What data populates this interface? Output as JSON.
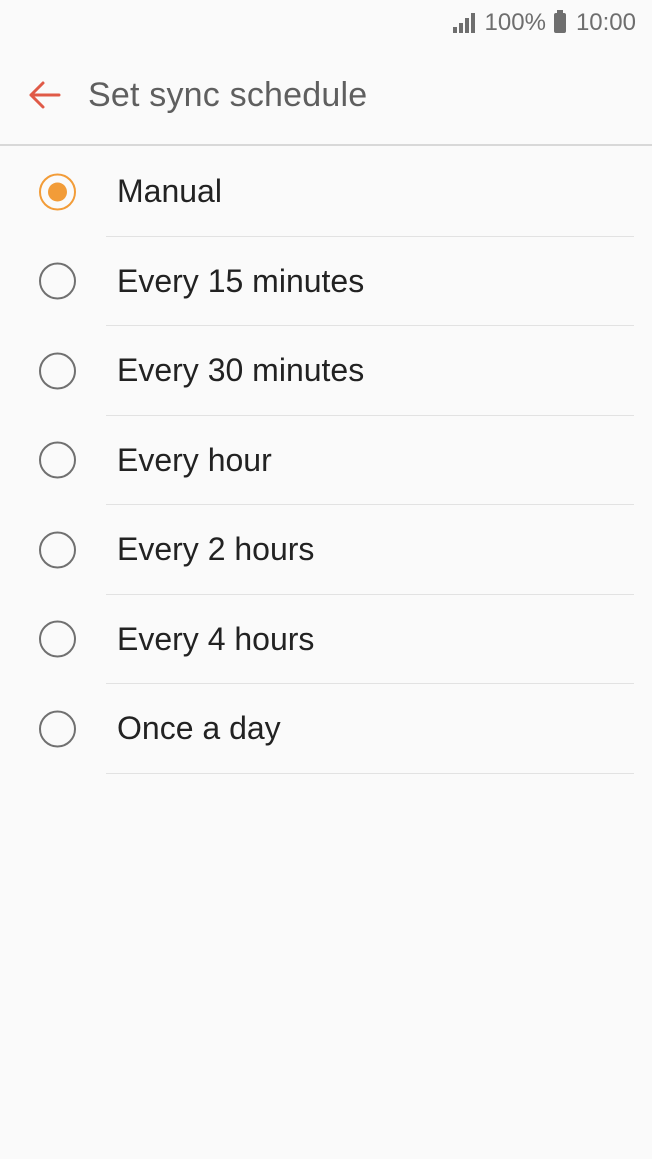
{
  "status_bar": {
    "battery_text": "100%",
    "time": "10:00",
    "icon_color": "#6e6e6e"
  },
  "app_bar": {
    "title": "Set sync schedule",
    "back_icon": "arrow-left-icon",
    "accent": "#e05a47"
  },
  "options": {
    "selected_color": "#f29c38",
    "items": [
      {
        "label": "Manual",
        "selected": true
      },
      {
        "label": "Every 15 minutes",
        "selected": false
      },
      {
        "label": "Every 30 minutes",
        "selected": false
      },
      {
        "label": "Every hour",
        "selected": false
      },
      {
        "label": "Every 2 hours",
        "selected": false
      },
      {
        "label": "Every 4 hours",
        "selected": false
      },
      {
        "label": "Once a day",
        "selected": false
      }
    ]
  }
}
